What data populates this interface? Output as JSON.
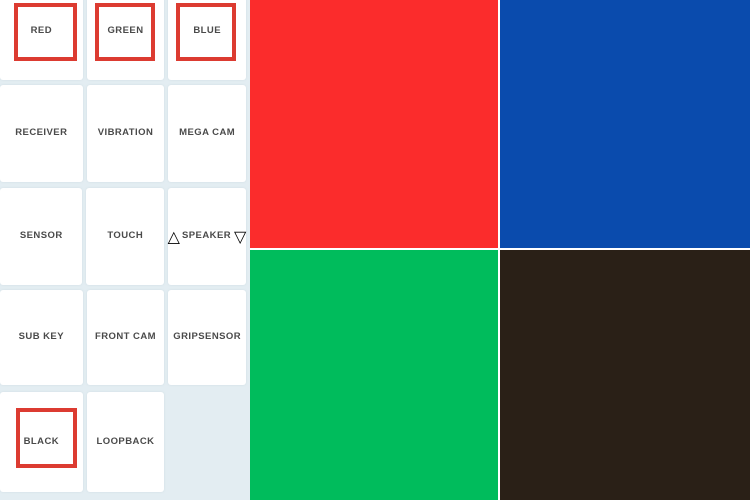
{
  "app": {
    "background_color": "#e3edf2",
    "panel_card_color": "#ffffff",
    "label_color": "#4a4a4a",
    "annotation_color": "#dc3b31"
  },
  "menu": {
    "rows": [
      {
        "cells": [
          {
            "label": "RED",
            "highlighted": true,
            "name": "menu-item-red"
          },
          {
            "label": "GREEN",
            "highlighted": true,
            "name": "menu-item-green"
          },
          {
            "label": "BLUE",
            "highlighted": true,
            "name": "menu-item-blue"
          }
        ]
      },
      {
        "cells": [
          {
            "label": "RECEIVER",
            "highlighted": false,
            "name": "menu-item-receiver"
          },
          {
            "label": "VIBRATION",
            "highlighted": false,
            "name": "menu-item-vibration"
          },
          {
            "label": "MEGA CAM",
            "highlighted": false,
            "name": "menu-item-mega-cam"
          }
        ]
      },
      {
        "cells": [
          {
            "label": "SENSOR",
            "highlighted": false,
            "name": "menu-item-sensor"
          },
          {
            "label": "TOUCH",
            "highlighted": false,
            "name": "menu-item-touch"
          },
          {
            "label": "SPEAKER",
            "highlighted": false,
            "name": "menu-item-speaker",
            "prefix_icon": "triangle-up-icon",
            "prefix_glyph": "△",
            "suffix_icon": "triangle-down-icon",
            "suffix_glyph": "▽"
          }
        ]
      },
      {
        "cells": [
          {
            "label": "SUB KEY",
            "highlighted": false,
            "name": "menu-item-sub-key"
          },
          {
            "label": "FRONT CAM",
            "highlighted": false,
            "name": "menu-item-front-cam"
          },
          {
            "label": "GRIPSENSOR",
            "highlighted": false,
            "name": "menu-item-gripsensor"
          }
        ]
      },
      {
        "cells": [
          {
            "label": "BLACK",
            "highlighted": true,
            "name": "menu-item-black"
          },
          {
            "label": "LOOPBACK",
            "highlighted": false,
            "name": "menu-item-loopback"
          },
          {
            "label": "",
            "highlighted": false,
            "name": "menu-item-empty",
            "empty": true
          }
        ]
      }
    ]
  },
  "color_panel": {
    "quadrants": [
      {
        "name": "color-swatch-red",
        "label": "RED",
        "color": "#fb2c2c"
      },
      {
        "name": "color-swatch-blue",
        "label": "BLUE",
        "color": "#0a4bad"
      },
      {
        "name": "color-swatch-green",
        "label": "GREEN",
        "color": "#00bc5c"
      },
      {
        "name": "color-swatch-black",
        "label": "BLACK",
        "color": "#2a2017"
      }
    ]
  }
}
